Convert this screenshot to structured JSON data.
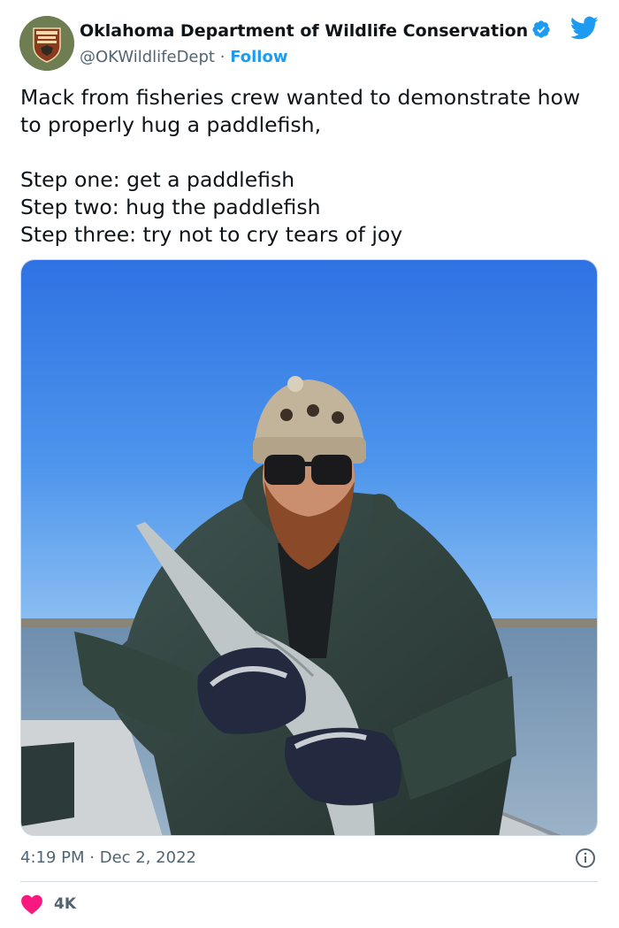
{
  "author": {
    "display_name": "Oklahoma Department of Wildlife Conservation",
    "handle": "@OKWildlifeDept",
    "separator": "·",
    "follow_label": "Follow",
    "avatar_icon": "odwc-badge-logo",
    "verified_icon": "verified-badge-icon"
  },
  "tweet": {
    "lines": [
      "Mack from fisheries crew wanted to demonstrate how to properly hug a paddlefish,",
      "",
      "Step one: get a paddlefish",
      "Step two: hug the paddlefish",
      "Step three: try not to cry tears of joy"
    ],
    "photo_description_icon": "photo-man-hugging-paddlefish-on-boat"
  },
  "meta": {
    "time": "4:19 PM",
    "separator": "·",
    "date": "Dec 2, 2022",
    "info_icon": "info-icon"
  },
  "engagement": {
    "like_icon": "heart-icon",
    "like_count": "4K"
  },
  "colors": {
    "accent": "#1d9bf0",
    "text": "#0f1419",
    "secondary": "#536471",
    "like": "#f91880"
  }
}
